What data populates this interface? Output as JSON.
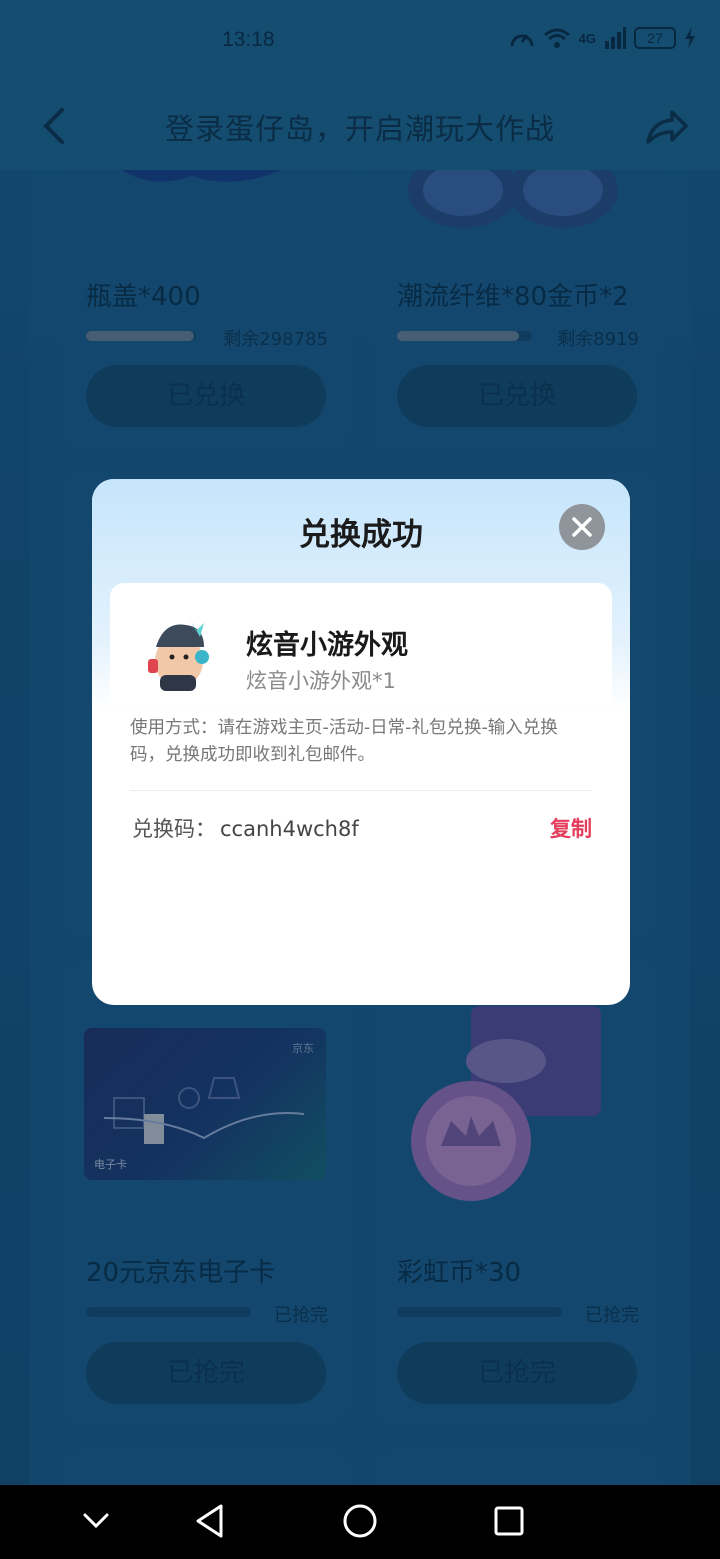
{
  "status_bar": {
    "time": "13:18",
    "network": "4G",
    "battery": "27"
  },
  "header": {
    "title": "登录蛋仔岛，开启潮玩大作战"
  },
  "cards": [
    {
      "title": "瓶盖*400",
      "remain": "剩余298785",
      "button": "已兑换",
      "progress": 0.98
    },
    {
      "title": "潮流纤维*80金币*2",
      "remain": "剩余8919",
      "button": "已兑换",
      "progress": 0.9
    },
    {
      "title": "20元京东电子卡",
      "remain": "已抢完",
      "button": "已抢完",
      "progress": 0
    },
    {
      "title": "彩虹币*30",
      "remain": "已抢完",
      "button": "已抢完",
      "progress": 0
    }
  ],
  "jd_card": {
    "brand": "京东",
    "label": "电子卡"
  },
  "modal": {
    "title": "兑换成功",
    "prize_name": "炫音小游外观",
    "prize_sub": "炫音小游外观*1",
    "usage": "使用方式：请在游戏主页-活动-日常-礼包兑换-输入兑换码，兑换成功即收到礼包邮件。",
    "code_label": "兑换码：",
    "code_value": "ccanh4wch8f",
    "copy_label": "复制"
  }
}
